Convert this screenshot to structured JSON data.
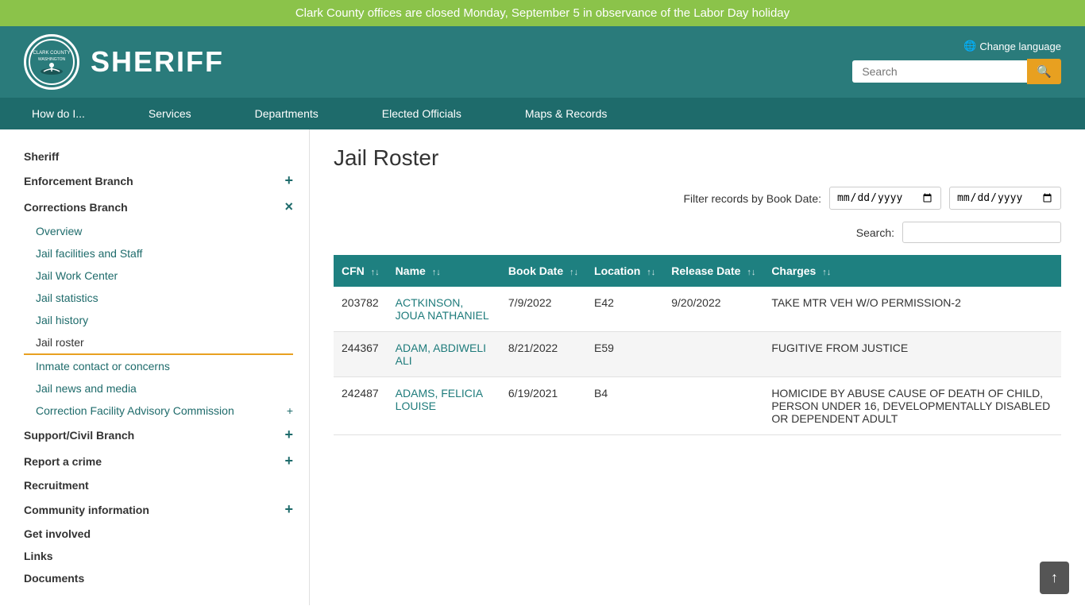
{
  "banner": {
    "text": "Clark County offices are closed Monday, September 5 in observance of the Labor Day holiday"
  },
  "header": {
    "sheriff_title": "SHERIFF",
    "change_language": "Change language",
    "search_placeholder": "Search"
  },
  "nav": {
    "items": [
      {
        "label": "How do I...",
        "id": "how-do-i"
      },
      {
        "label": "Services",
        "id": "services"
      },
      {
        "label": "Departments",
        "id": "departments"
      },
      {
        "label": "Elected Officials",
        "id": "elected-officials"
      },
      {
        "label": "Maps & Records",
        "id": "maps-records"
      }
    ]
  },
  "sidebar": {
    "top_items": [
      {
        "label": "Sheriff",
        "level": "top",
        "has_expand": false
      },
      {
        "label": "Enforcement Branch",
        "level": "top",
        "has_expand": true,
        "expand_icon": "+"
      },
      {
        "label": "Corrections Branch",
        "level": "top",
        "has_expand": true,
        "expand_icon": "×"
      },
      {
        "label": "Support/Civil Branch",
        "level": "top",
        "has_expand": true,
        "expand_icon": "+"
      },
      {
        "label": "Report a crime",
        "level": "top",
        "has_expand": true,
        "expand_icon": "+"
      },
      {
        "label": "Recruitment",
        "level": "top",
        "has_expand": false
      },
      {
        "label": "Community information",
        "level": "top",
        "has_expand": true,
        "expand_icon": "+"
      },
      {
        "label": "Get involved",
        "level": "top",
        "has_expand": false
      },
      {
        "label": "Links",
        "level": "top",
        "has_expand": false
      },
      {
        "label": "Documents",
        "level": "top",
        "has_expand": false
      }
    ],
    "sub_items": [
      {
        "label": "Overview",
        "active": false
      },
      {
        "label": "Jail facilities and Staff",
        "active": false
      },
      {
        "label": "Jail Work Center",
        "active": false
      },
      {
        "label": "Jail statistics",
        "active": false
      },
      {
        "label": "Jail history",
        "active": false
      },
      {
        "label": "Jail roster",
        "active": true
      },
      {
        "label": "Inmate contact or concerns",
        "active": false
      },
      {
        "label": "Jail news and media",
        "active": false
      },
      {
        "label": "Correction Facility Advisory Commission",
        "active": false,
        "has_expand": true,
        "expand_icon": "+"
      }
    ]
  },
  "main": {
    "title": "Jail Roster",
    "filter_label": "Filter records by Book Date:",
    "search_label": "Search:",
    "table": {
      "columns": [
        {
          "label": "CFN",
          "sortable": true
        },
        {
          "label": "Name",
          "sortable": true
        },
        {
          "label": "Book Date",
          "sortable": true
        },
        {
          "label": "Location",
          "sortable": true
        },
        {
          "label": "Release Date",
          "sortable": true
        },
        {
          "label": "Charges",
          "sortable": true
        }
      ],
      "rows": [
        {
          "cfn": "203782",
          "name": "ACTKINSON, JOUA NATHANIEL",
          "book_date": "7/9/2022",
          "location": "E42",
          "release_date": "9/20/2022",
          "charges": "TAKE MTR VEH W/O PERMISSION-2"
        },
        {
          "cfn": "244367",
          "name": "ADAM, ABDIWELI ALI",
          "book_date": "8/21/2022",
          "location": "E59",
          "release_date": "",
          "charges": "FUGITIVE FROM JUSTICE"
        },
        {
          "cfn": "242487",
          "name": "ADAMS, FELICIA LOUISE",
          "book_date": "6/19/2021",
          "location": "B4",
          "release_date": "",
          "charges": "HOMICIDE BY ABUSE CAUSE OF DEATH OF CHILD, PERSON UNDER 16, DEVELOPMENTALLY DISABLED OR DEPENDENT ADULT"
        }
      ]
    }
  },
  "scroll_top_icon": "↑"
}
